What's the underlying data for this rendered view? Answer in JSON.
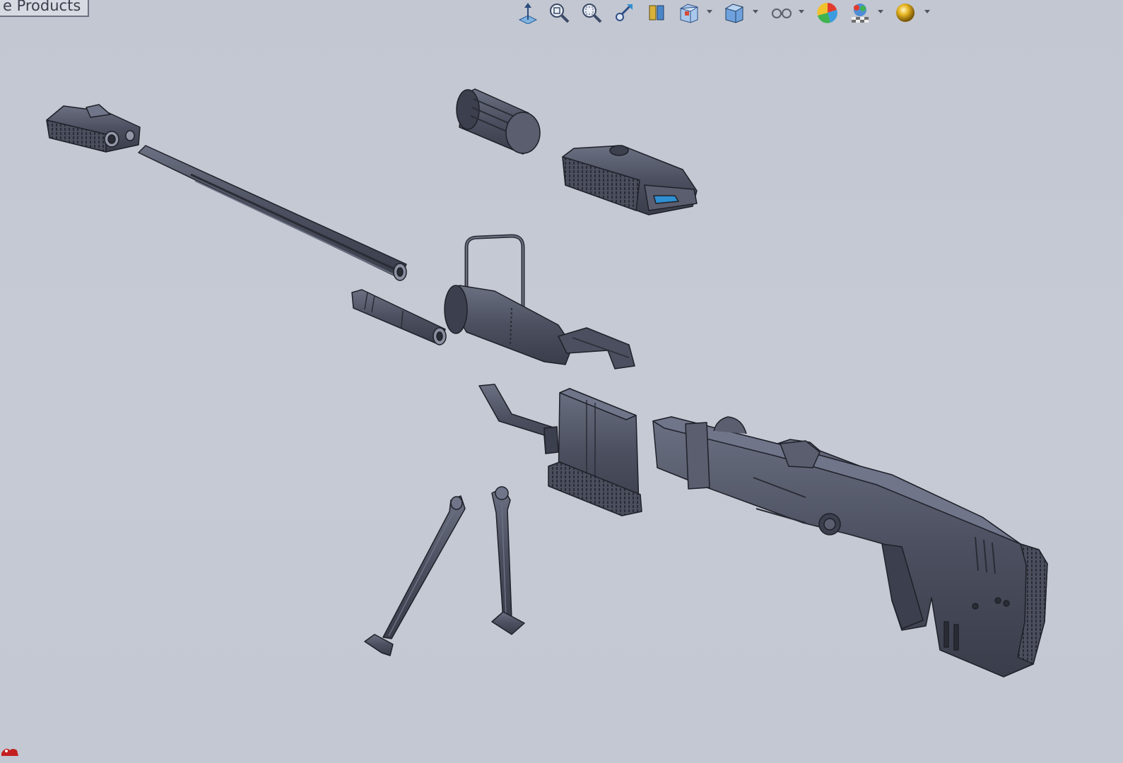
{
  "window": {
    "products_tab_label": "e Products"
  },
  "heads_up_toolbar": [
    {
      "icon": "normal-to-icon",
      "dropdown": false
    },
    {
      "icon": "zoom-to-fit-icon",
      "dropdown": false
    },
    {
      "icon": "zoom-to-area-icon",
      "dropdown": false
    },
    {
      "icon": "previous-view-icon",
      "dropdown": false
    },
    {
      "icon": "section-view-icon",
      "dropdown": false
    },
    {
      "icon": "view-orientation-icon",
      "dropdown": true
    },
    {
      "icon": "display-style-icon",
      "dropdown": true
    },
    {
      "icon": "hide-show-items-icon",
      "dropdown": true
    },
    {
      "icon": "edit-appearance-icon",
      "dropdown": false
    },
    {
      "icon": "apply-scene-icon",
      "dropdown": true
    },
    {
      "icon": "view-settings-icon",
      "dropdown": true
    }
  ],
  "model": {
    "parts": [
      "muzzle-brake",
      "barrel",
      "grip-cylinder",
      "scope-mount-block",
      "bolt",
      "scope-with-handle",
      "rail-bracket",
      "magazine",
      "bipod-leg-left",
      "bipod-leg-right",
      "receiver-stock"
    ],
    "colors": {
      "part_fill": "#4d5161",
      "part_edge": "#1f2129",
      "part_highlight": "#70758a",
      "background": "#c5c9d3",
      "accent_blue": "#2e8fd1"
    }
  }
}
